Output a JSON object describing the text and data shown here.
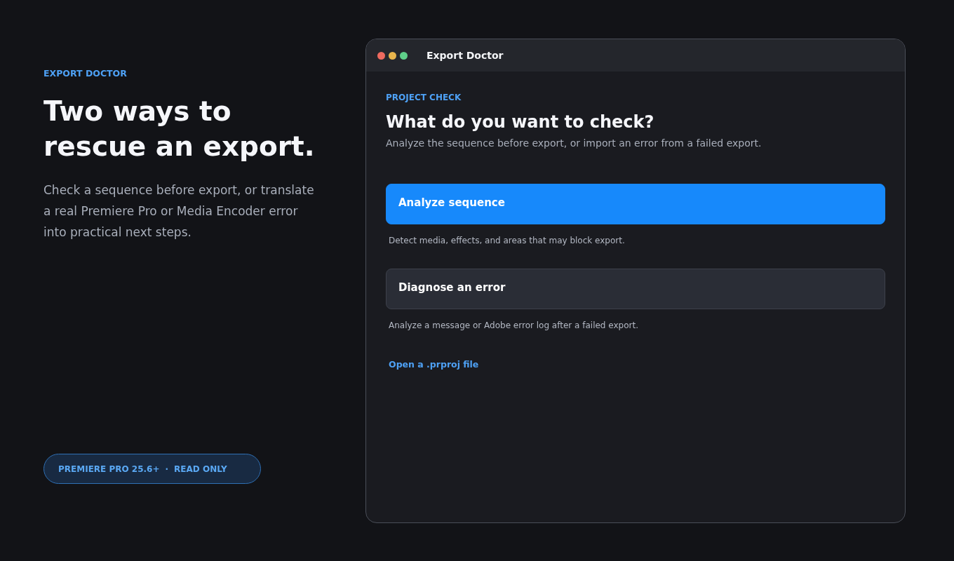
{
  "intro": {
    "eyebrow": "EXPORT DOCTOR",
    "heading": "Two ways to rescue an export.",
    "description": "Check a sequence before export, or translate a real Premiere Pro or Media Encoder error into practical next steps.",
    "badge": [
      "PREMIERE PRO 25.6+",
      "·",
      "READ ONLY"
    ]
  },
  "window": {
    "title": "Export Doctor",
    "controls": [
      {
        "color": "#ee6a5f"
      },
      {
        "color": "#e8b44c"
      },
      {
        "color": "#5fcf8a"
      }
    ]
  },
  "panel": {
    "eyebrow": "PROJECT CHECK",
    "heading": "What do you want to check?",
    "subtitle": "Analyze the sequence before export, or import an error from a failed export.",
    "options": [
      {
        "label": "Analyze sequence",
        "selected": true,
        "hint": "Detect media, effects, and areas that may block export."
      },
      {
        "label": "Diagnose an error",
        "selected": false,
        "hint": "Analyze a message or Adobe error log after a failed export."
      }
    ],
    "link": "Open a .prproj file"
  }
}
